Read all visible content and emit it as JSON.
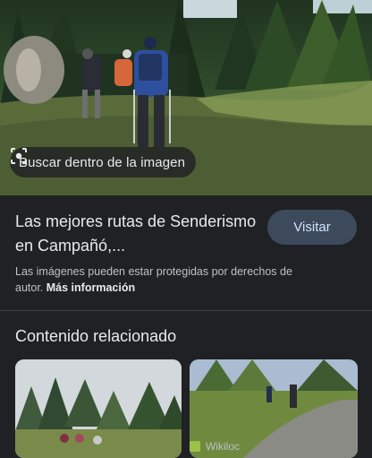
{
  "lens": {
    "label": "Buscar dentro de la imagen",
    "icon": "lens-scan-icon"
  },
  "result": {
    "title": "Las mejores rutas de Senderismo en Campañó,...",
    "visit_label": "Visitar",
    "note_text": "Las imágenes pueden estar protegidas por derechos de autor.",
    "more_label": "Más información"
  },
  "related": {
    "title": "Contenido relacionado",
    "card2_source": "Wikiloc"
  },
  "colors": {
    "background": "#202124",
    "visit_button": "#3c4a5c",
    "text": "#e8eaed"
  }
}
